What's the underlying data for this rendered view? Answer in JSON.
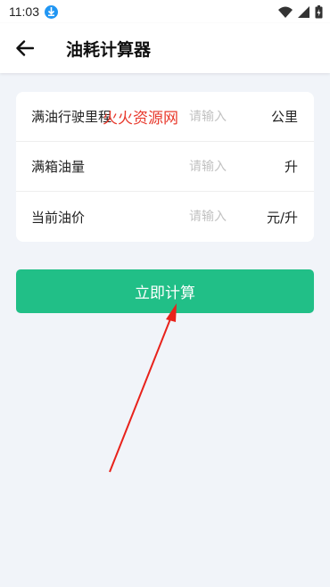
{
  "status_bar": {
    "time": "11:03",
    "download_icon": "download-icon",
    "wifi_icon": "wifi-icon",
    "signal_icon": "signal-icon",
    "battery_icon": "battery-charging-icon"
  },
  "app_bar": {
    "back_icon": "arrow-left-icon",
    "title": "油耗计算器"
  },
  "form": {
    "rows": [
      {
        "label": "满油行驶里程",
        "placeholder": "请输入",
        "unit": "公里"
      },
      {
        "label": "满箱油量",
        "placeholder": "请输入",
        "unit": "升"
      },
      {
        "label": "当前油价",
        "placeholder": "请输入",
        "unit": "元/升"
      }
    ]
  },
  "watermark": "火火资源网",
  "calculate_button": {
    "label": "立即计算"
  },
  "colors": {
    "accent": "#21bf87",
    "background": "#f1f4f9",
    "annotation_arrow": "#e8221b",
    "watermark": "#e8392c"
  }
}
